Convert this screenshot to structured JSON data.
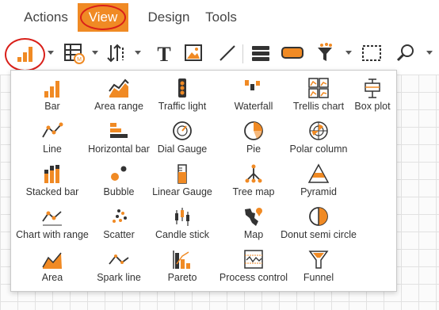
{
  "menubar": {
    "items": [
      {
        "label": "Actions"
      },
      {
        "label": "View"
      },
      {
        "label": "Design"
      },
      {
        "label": "Tools"
      }
    ]
  },
  "colors": {
    "accent": "#f08a24",
    "highlight_ring": "#d9201a",
    "icon_dark": "#333333"
  },
  "toolbar": {
    "buttons": [
      {
        "icon": "bar-chart-icon"
      },
      {
        "icon": "table-grid-icon"
      },
      {
        "icon": "sort-icon"
      },
      {
        "icon": "text-icon"
      },
      {
        "icon": "image-icon"
      },
      {
        "icon": "line-icon"
      },
      {
        "icon": "list-icon"
      },
      {
        "icon": "button-shape-icon"
      },
      {
        "icon": "filter-funnel-icon"
      },
      {
        "icon": "selection-box-icon"
      },
      {
        "icon": "search-icon"
      }
    ]
  },
  "chart_menu": {
    "items": [
      {
        "label": "Bar",
        "icon": "bar-icon"
      },
      {
        "label": "Area range",
        "icon": "area-range-icon"
      },
      {
        "label": "Traffic light",
        "icon": "traffic-light-icon"
      },
      {
        "label": "Waterfall",
        "icon": "waterfall-icon"
      },
      {
        "label": "Trellis chart",
        "icon": "trellis-chart-icon"
      },
      {
        "label": "Box plot",
        "icon": "box-plot-icon"
      },
      {
        "label": "Line",
        "icon": "line-chart-icon"
      },
      {
        "label": "Horizontal bar",
        "icon": "horizontal-bar-icon"
      },
      {
        "label": "Dial Gauge",
        "icon": "dial-gauge-icon"
      },
      {
        "label": "Pie",
        "icon": "pie-icon"
      },
      {
        "label": "Polar column",
        "icon": "polar-column-icon"
      },
      {
        "label": "Stacked bar",
        "icon": "stacked-bar-icon"
      },
      {
        "label": "Bubble",
        "icon": "bubble-icon"
      },
      {
        "label": "Linear Gauge",
        "icon": "linear-gauge-icon"
      },
      {
        "label": "Tree map",
        "icon": "tree-map-icon"
      },
      {
        "label": "Pyramid",
        "icon": "pyramid-icon"
      },
      {
        "label": "Chart with range",
        "icon": "chart-with-range-icon"
      },
      {
        "label": "Scatter",
        "icon": "scatter-icon"
      },
      {
        "label": "Candle stick",
        "icon": "candle-stick-icon"
      },
      {
        "label": "Map",
        "icon": "map-icon"
      },
      {
        "label": "Donut semi circle",
        "icon": "donut-semi-circle-icon"
      },
      {
        "label": "Area",
        "icon": "area-icon"
      },
      {
        "label": "Spark line",
        "icon": "spark-line-icon"
      },
      {
        "label": "Pareto",
        "icon": "pareto-icon"
      },
      {
        "label": "Process control",
        "icon": "process-control-icon"
      },
      {
        "label": "Funnel",
        "icon": "funnel-icon"
      }
    ]
  }
}
